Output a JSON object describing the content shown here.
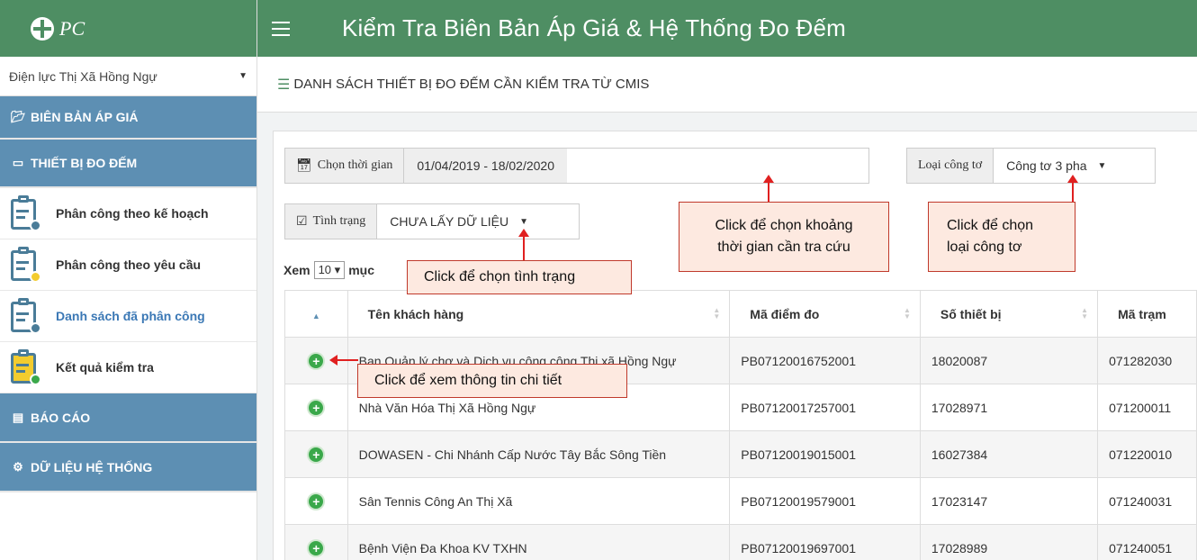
{
  "brand": {
    "name": "PC"
  },
  "sidebar": {
    "unit_select": "Điện lực Thị Xã Hồng Ngự",
    "sections": [
      {
        "label": "BIÊN BẢN ÁP GIÁ",
        "icon": "folder-open-icon"
      },
      {
        "label": "THIẾT BỊ ĐO ĐẾM",
        "icon": "laptop-icon"
      },
      {
        "label": "BÁO CÁO",
        "icon": "list-alt-icon"
      },
      {
        "label": "DỮ LIỆU HỆ THỐNG",
        "icon": "cogs-icon"
      }
    ],
    "items": [
      {
        "label": "Phân công theo kế hoạch",
        "icon": "clipboard-gear-icon"
      },
      {
        "label": "Phân công theo yêu cầu",
        "icon": "clipboard-user-icon"
      },
      {
        "label": "Danh sách đã phân công",
        "icon": "clipboard-gear-icon"
      },
      {
        "label": "Kết quả kiểm tra",
        "icon": "clipboard-check-icon"
      }
    ]
  },
  "header": {
    "title": "Kiểm Tra Biên Bản Áp Giá & Hệ Thống Đo Đếm"
  },
  "page": {
    "heading": "DANH SÁCH THIẾT BỊ ĐO ĐẾM CẦN KIỂM TRA TỪ CMIS"
  },
  "filters": {
    "time_label": "Chọn thời gian",
    "time_value": "01/04/2019 - 18/02/2020",
    "meter_type_label": "Loại công tơ",
    "meter_type_value": "Công tơ 3 pha",
    "status_label": "Tình trạng",
    "status_value": "CHƯA LẤY DỮ LIỆU"
  },
  "entries": {
    "prefix": "Xem",
    "value": "10",
    "suffix": "mục"
  },
  "table": {
    "columns": [
      "Tên khách hàng",
      "Mã điểm đo",
      "Số thiết bị",
      "Mã trạm"
    ],
    "rows": [
      [
        "Ban Quản lý chợ và Dịch vụ công cộng Thị xã Hồng Ngự",
        "PB07120016752001",
        "18020087",
        "071282030"
      ],
      [
        "Nhà Văn Hóa Thị Xã Hồng Ngự",
        "PB07120017257001",
        "17028971",
        "071200011"
      ],
      [
        "DOWASEN - Chi Nhánh Cấp Nước Tây Bắc Sông Tiền",
        "PB07120019015001",
        "16027384",
        "071220010"
      ],
      [
        "Sân Tennis Công An Thị Xã",
        "PB07120019579001",
        "17023147",
        "071240031"
      ],
      [
        "Bệnh Viện Đa Khoa  KV TXHN",
        "PB07120019697001",
        "17028989",
        "071240051"
      ]
    ]
  },
  "annotations": {
    "status": "Click để chọn tình trạng",
    "time_line1": "Click để chọn khoảng",
    "time_line2": "thời gian cần tra cứu",
    "meter_line1": "Click để chọn",
    "meter_line2": "loại công tơ",
    "detail": "Click để xem thông tin chi tiết"
  },
  "colors": {
    "header_green": "#4e8e63",
    "menu_blue": "#5d8fb3",
    "callout_border": "#c0392b",
    "arrow_red": "#e02020"
  }
}
